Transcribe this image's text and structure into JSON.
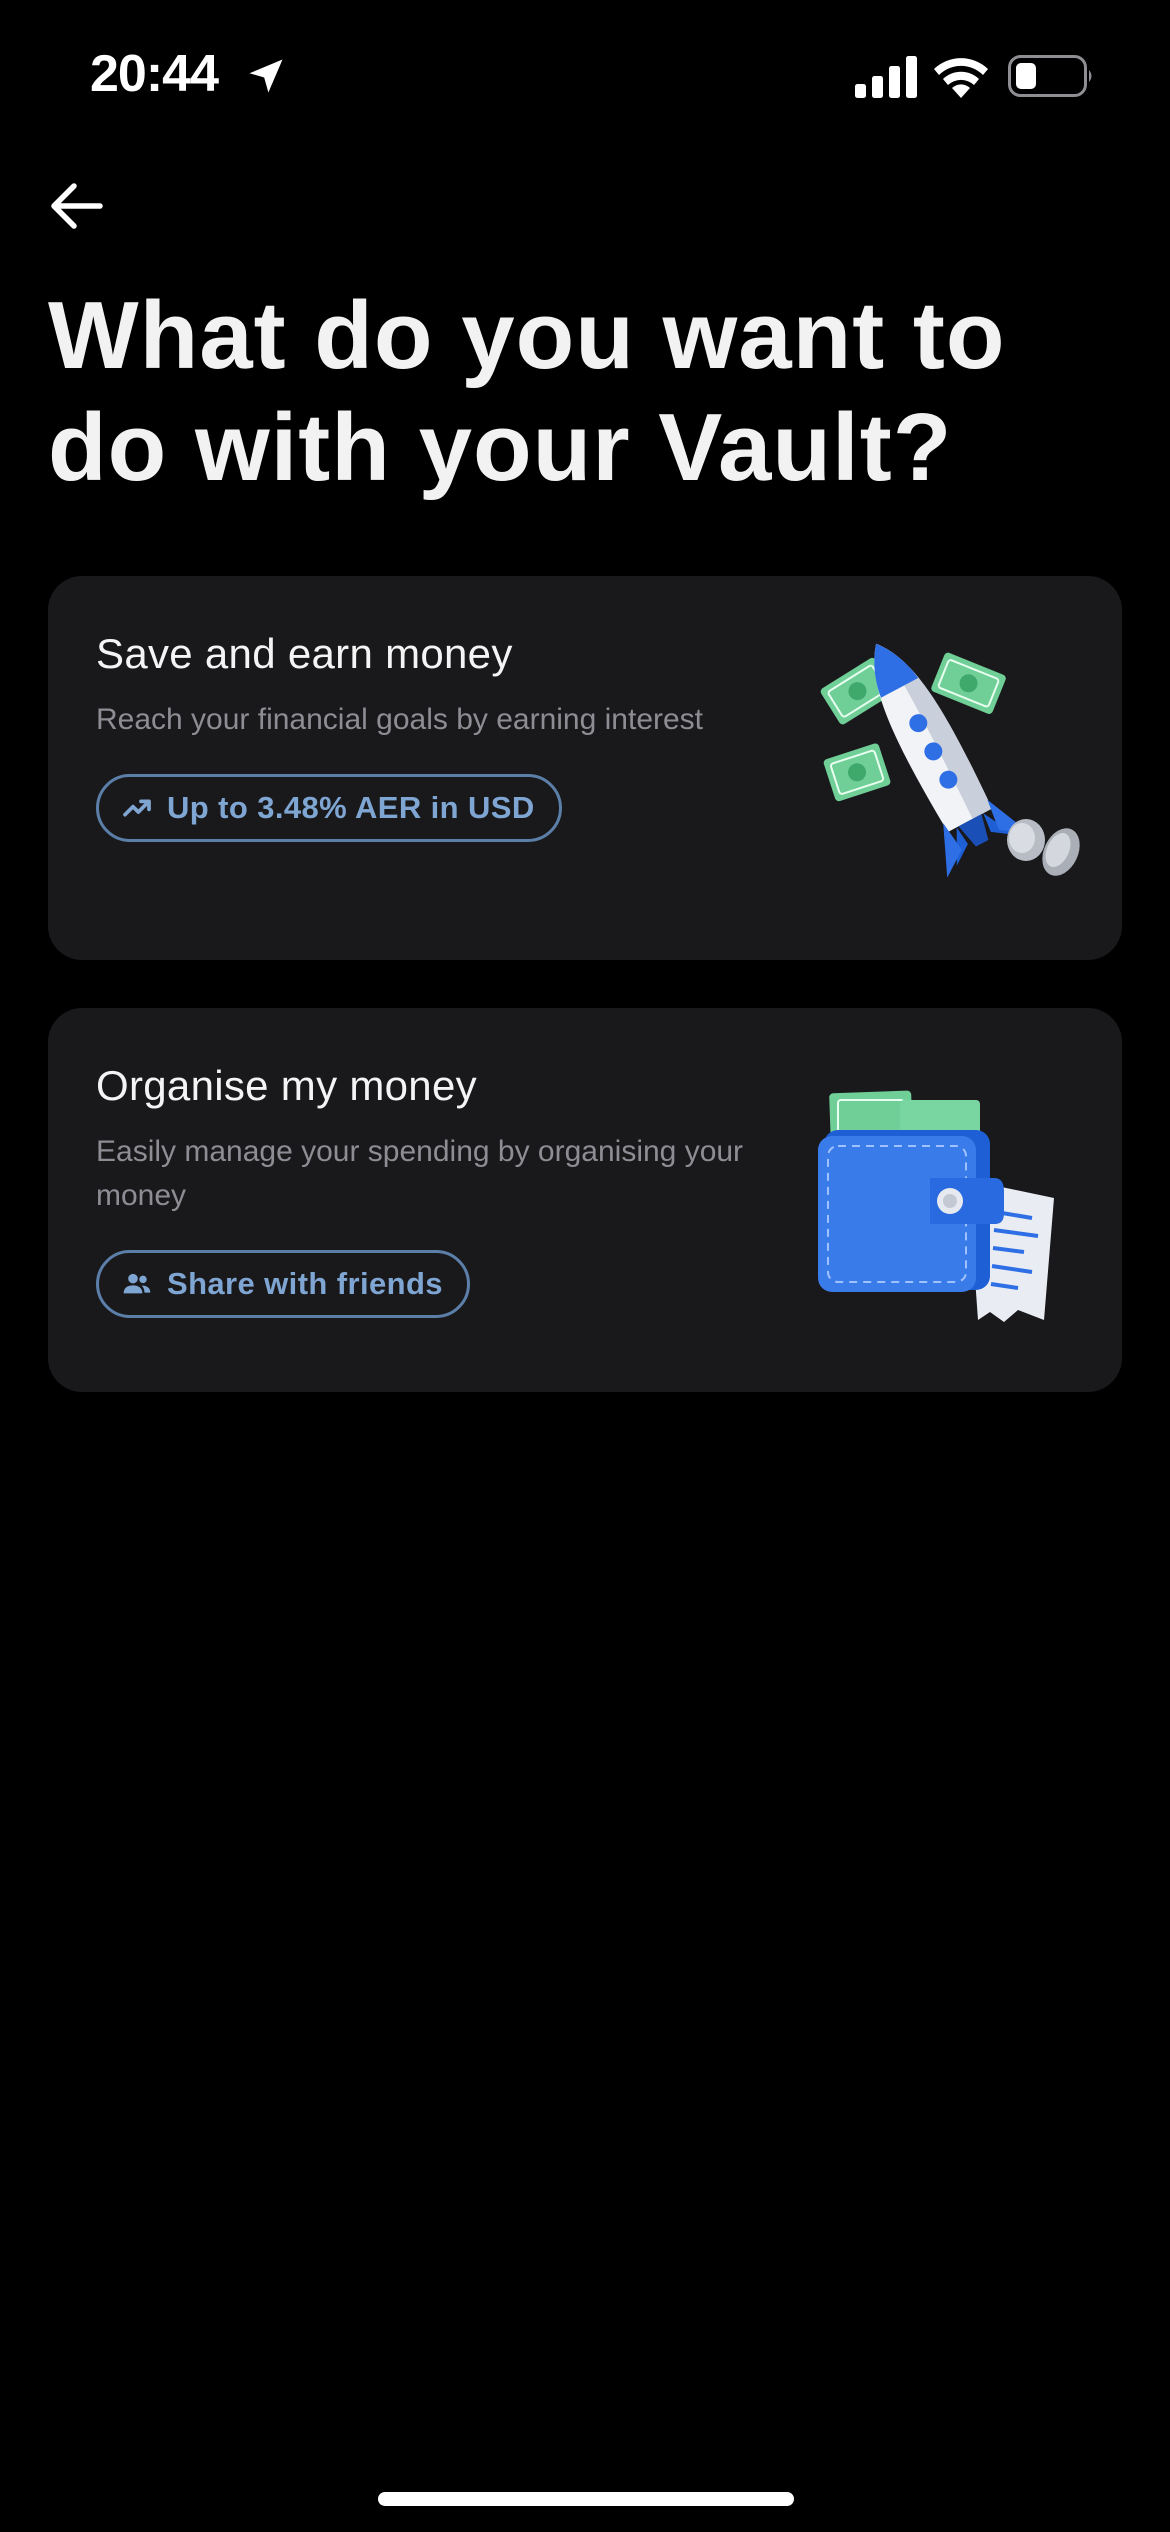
{
  "status_bar": {
    "time": "20:44",
    "icons": [
      "location-arrow-icon",
      "cellular-signal-icon",
      "wifi-icon",
      "battery-icon"
    ]
  },
  "header": {
    "back_icon": "arrow-left-icon",
    "title": "What do you want to do with your Vault?"
  },
  "options": [
    {
      "title": "Save and earn money",
      "description": "Reach your financial goals by earning interest",
      "pill_icon": "trending-up-icon",
      "pill_label": "Up to 3.48% AER in USD",
      "illustration": "rocket-with-money-illustration"
    },
    {
      "title": "Organise my money",
      "description": "Easily manage your spending by organising your money",
      "pill_icon": "people-icon",
      "pill_label": "Share with friends",
      "illustration": "wallet-with-receipt-illustration"
    }
  ],
  "colors": {
    "background": "#000000",
    "card": "#19191c",
    "accent": "#7fa5d2",
    "pill_border": "#5b7fa8",
    "secondary_text": "#8d8d93"
  }
}
